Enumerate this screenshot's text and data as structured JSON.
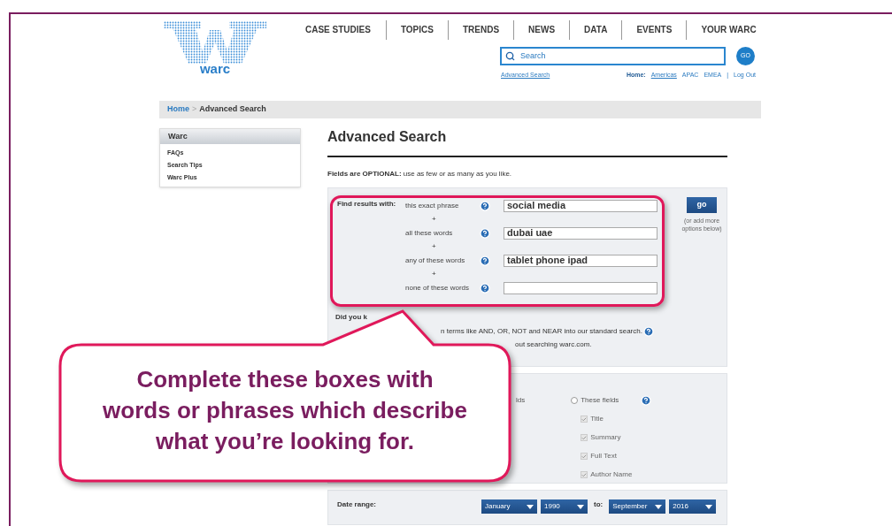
{
  "logo": {
    "wordmark": "warc"
  },
  "nav": [
    "CASE STUDIES",
    "TOPICS",
    "TRENDS",
    "NEWS",
    "DATA",
    "EVENTS",
    "YOUR WARC"
  ],
  "search": {
    "placeholder": "Search",
    "button": "GO"
  },
  "links": {
    "advanced": "Advanced Search",
    "home_label": "Home:",
    "regions": [
      {
        "label": "Americas",
        "selected": true
      },
      {
        "label": "APAC",
        "selected": false
      },
      {
        "label": "EMEA",
        "selected": false
      }
    ],
    "separator": "|",
    "logout": "Log Out"
  },
  "breadcrumb": {
    "items": [
      "Home",
      "Advanced Search"
    ],
    "separator": ">"
  },
  "sidebar": {
    "title": "Warc",
    "items": [
      "FAQs",
      "Search Tips",
      "Warc Plus"
    ]
  },
  "heading": "Advanced Search",
  "intro": "**Fields are OPTIONAL:** use as few or as many as you like.",
  "find": {
    "label": "Find results with:",
    "go": "go",
    "go_note": "(or add more options below)",
    "rows": [
      {
        "label": "this exact phrase",
        "value": "social media",
        "plus": "+"
      },
      {
        "label": "all these words",
        "value": "dubai uae",
        "plus": "+"
      },
      {
        "label": "any of these words",
        "value": "tablet phone ipad",
        "plus": "+"
      },
      {
        "label": "none of these words",
        "value": ""
      }
    ]
  },
  "tips": {
    "title": "Did you k",
    "lines": [
      "n terms like AND, OR, NOT and NEAR into our standard search.",
      "out searching warc.com."
    ]
  },
  "fields": {
    "fragment": "lds",
    "radio": {
      "label": "These fields",
      "selected": false
    },
    "checks": [
      {
        "label": "Title",
        "checked": true,
        "disabled": true
      },
      {
        "label": "Summary",
        "checked": true,
        "disabled": true
      },
      {
        "label": "Full Text",
        "checked": true,
        "disabled": true
      },
      {
        "label": "Author Name",
        "checked": true,
        "disabled": true
      }
    ]
  },
  "date": {
    "label": "Date range:",
    "from": [
      "January",
      "1990"
    ],
    "to_label": "to:",
    "to": [
      "September",
      "2016"
    ]
  },
  "callout": "Complete these boxes with\nwords or phrases which describe\nwhat you’re looking for."
}
